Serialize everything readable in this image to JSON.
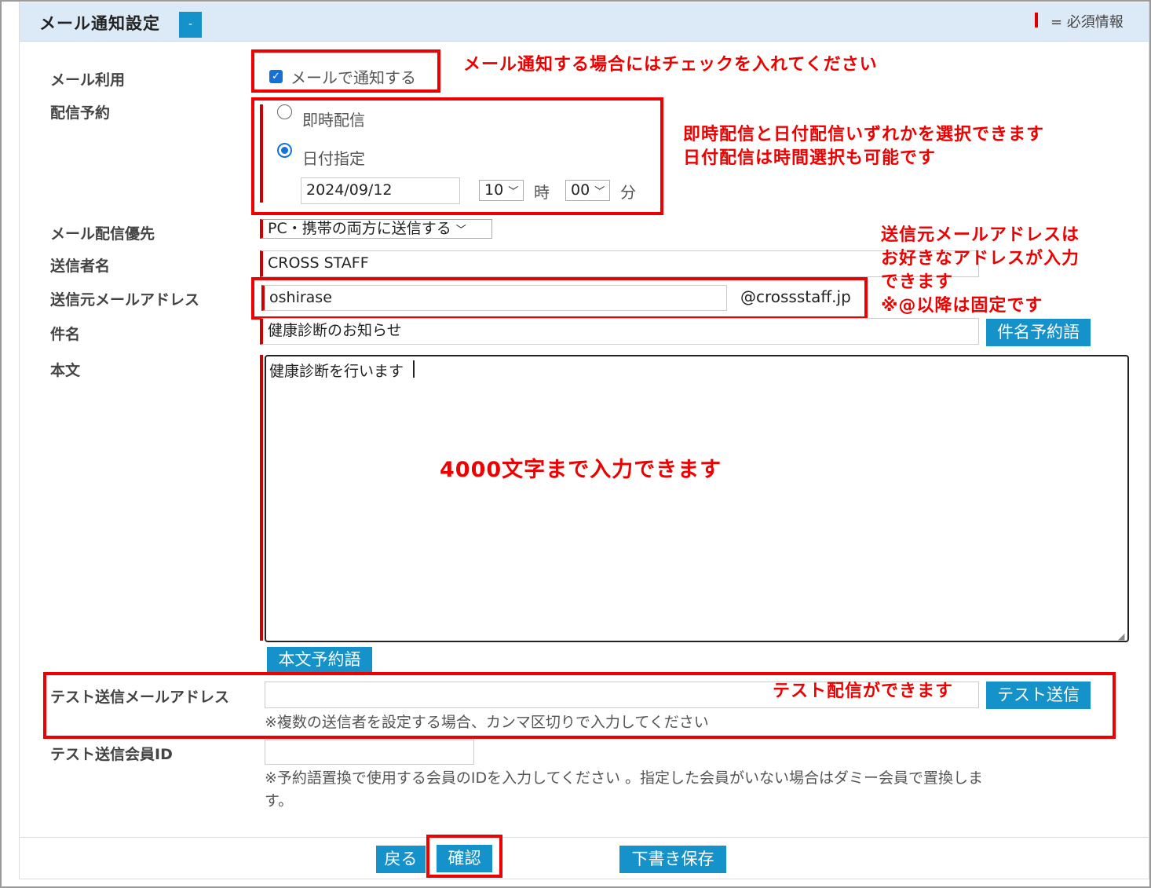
{
  "header": {
    "title": "メール通知設定",
    "toggle_label": "-",
    "required_legend": "= 必須情報"
  },
  "mail_use": {
    "label": "メール利用",
    "checkbox_label": "メールで通知する",
    "checked": true
  },
  "schedule": {
    "label": "配信予約",
    "option_immediate": "即時配信",
    "option_date": "日付指定",
    "selected": "日付指定",
    "date_value": "2024/09/12",
    "hour_value": "10",
    "hour_unit": "時",
    "minute_value": "00",
    "minute_unit": "分"
  },
  "priority": {
    "label": "メール配信優先",
    "value": "PC・携帯の両方に送信する"
  },
  "sender_name": {
    "label": "送信者名",
    "value": "CROSS STAFF"
  },
  "sender_address": {
    "label": "送信元メールアドレス",
    "value": "oshirase",
    "domain": "@crossstaff.jp"
  },
  "subject": {
    "label": "件名",
    "value": "健康診断のお知らせ",
    "button": "件名予約語"
  },
  "body": {
    "label": "本文",
    "value": "健康診断を行います",
    "button": "本文予約語"
  },
  "test_address": {
    "label": "テスト送信メールアドレス",
    "value": "",
    "button": "テスト送信",
    "hint": "※複数の送信者を設定する場合、カンマ区切りで入力してください"
  },
  "test_member": {
    "label": "テスト送信会員ID",
    "value": "",
    "hint_line1": "※予約語置換で使用する会員のIDを入力してください 。指定した会員がいない場合はダミー会員で置換しま",
    "hint_line2": "す。"
  },
  "footer": {
    "back": "戻る",
    "confirm": "確認",
    "draft": "下書き保存"
  },
  "annotations": {
    "mail_use": "メール通知する場合にはチェックを入れてください",
    "schedule_line1": "即時配信と日付配信いずれかを選択できます",
    "schedule_line2": "日付配信は時間選択も可能です",
    "sender_line1": "送信元メールアドレスは",
    "sender_line2": "お好きなアドレスが入力",
    "sender_line3": "できます",
    "sender_line4": "※@以降は固定です",
    "body": "4000文字まで入力できます",
    "test": "テスト配信ができます"
  },
  "colors": {
    "accent": "#1592c9",
    "required": "#cc0000",
    "annotation": "#ee0000",
    "header_bg": "#dce9f6"
  }
}
